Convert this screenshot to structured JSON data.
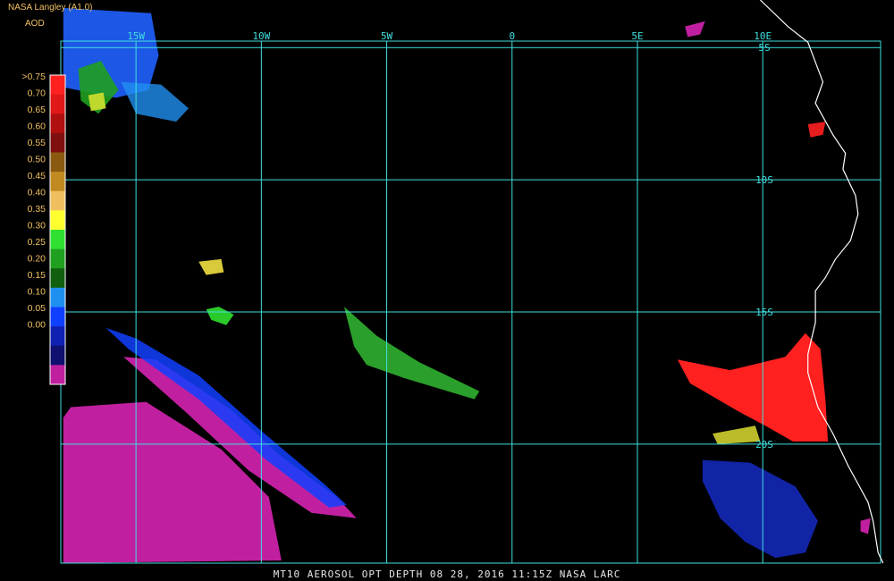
{
  "header": {
    "agency": "NASA Langley (A1.0)",
    "product": "AOD"
  },
  "footer": {
    "caption": "MT10  AEROSOL OPT DEPTH   08 28, 2016 11:15Z   NASA LARC"
  },
  "colors": {
    "background": "#000000",
    "grid": "#40e0e0",
    "coast": "#ffffff",
    "labels": "#f0c060"
  },
  "map": {
    "lon_range": [
      -18,
      14.7
    ],
    "lat_range": [
      -3.2,
      -24.5
    ],
    "lon_ticks": [
      {
        "value": -15,
        "label": "15W"
      },
      {
        "value": -10,
        "label": "10W"
      },
      {
        "value": -5,
        "label": "5W"
      },
      {
        "value": 0,
        "label": "0"
      },
      {
        "value": 5,
        "label": "5E"
      },
      {
        "value": 10,
        "label": "10E"
      }
    ],
    "lat_ticks": [
      {
        "value": -5,
        "label": "5S"
      },
      {
        "value": -10,
        "label": "10S"
      },
      {
        "value": -15,
        "label": "15S"
      },
      {
        "value": -20,
        "label": "20S"
      }
    ]
  },
  "colorbar": {
    "entries": [
      {
        "label": ">0.75",
        "color": "#ff2020"
      },
      {
        "label": "0.70",
        "color": "#e01818"
      },
      {
        "label": "0.65",
        "color": "#b01010"
      },
      {
        "label": "0.60",
        "color": "#801010"
      },
      {
        "label": "0.55",
        "color": "#8a5a10"
      },
      {
        "label": "0.50",
        "color": "#c08a20"
      },
      {
        "label": "0.45",
        "color": "#f0c060"
      },
      {
        "label": "0.40",
        "color": "#ffff30"
      },
      {
        "label": "0.35",
        "color": "#30e030"
      },
      {
        "label": "0.30",
        "color": "#20a020"
      },
      {
        "label": "0.25",
        "color": "#106010"
      },
      {
        "label": "0.20",
        "color": "#2090f0"
      },
      {
        "label": "0.15",
        "color": "#1040ff"
      },
      {
        "label": "0.10",
        "color": "#1020b0"
      },
      {
        "label": "0.05",
        "color": "#101070"
      },
      {
        "label": "0.00",
        "color": "#c020a0"
      }
    ]
  },
  "features": [
    {
      "name": "blob-nw-blue",
      "color": "#2060ff",
      "opacity": 0.9,
      "points": [
        [
          -17.9,
          -3.5
        ],
        [
          -14.4,
          -3.7
        ],
        [
          -14.1,
          -5.3
        ],
        [
          -14.5,
          -6.6
        ],
        [
          -15.8,
          -6.9
        ],
        [
          -17.9,
          -6.5
        ]
      ]
    },
    {
      "name": "blob-nw-lightblue",
      "color": "#2090f0",
      "opacity": 0.8,
      "points": [
        [
          -15.6,
          -6.3
        ],
        [
          -14.0,
          -6.4
        ],
        [
          -12.9,
          -7.3
        ],
        [
          -13.4,
          -7.8
        ],
        [
          -15.0,
          -7.5
        ]
      ]
    },
    {
      "name": "blob-nw-green",
      "color": "#20a020",
      "opacity": 0.9,
      "points": [
        [
          -17.3,
          -5.8
        ],
        [
          -16.4,
          -5.5
        ],
        [
          -15.7,
          -6.6
        ],
        [
          -16.5,
          -7.5
        ],
        [
          -17.2,
          -7.0
        ]
      ]
    },
    {
      "name": "blob-nw-yellow",
      "color": "#d0e030",
      "opacity": 0.9,
      "points": [
        [
          -16.9,
          -6.8
        ],
        [
          -16.3,
          -6.7
        ],
        [
          -16.2,
          -7.3
        ],
        [
          -16.8,
          -7.4
        ]
      ]
    },
    {
      "name": "blob-nw-magenta-small",
      "color": "#c020a0",
      "opacity": 1,
      "points": [
        [
          6.9,
          -4.2
        ],
        [
          7.7,
          -4.0
        ],
        [
          7.5,
          -4.5
        ],
        [
          7.0,
          -4.6
        ]
      ]
    },
    {
      "name": "blob-sw-magenta-1",
      "color": "#c020a0",
      "opacity": 1,
      "points": [
        [
          -17.6,
          -18.6
        ],
        [
          -14.6,
          -18.4
        ],
        [
          -11.6,
          -20.2
        ],
        [
          -9.7,
          -22.0
        ],
        [
          -9.2,
          -24.4
        ],
        [
          -17.9,
          -24.5
        ],
        [
          -17.9,
          -19.0
        ]
      ]
    },
    {
      "name": "blob-sw-magenta-2",
      "color": "#c020a0",
      "opacity": 1,
      "points": [
        [
          -15.5,
          -16.7
        ],
        [
          -14.2,
          -16.8
        ],
        [
          -11.2,
          -18.7
        ],
        [
          -9.3,
          -20.4
        ],
        [
          -7.0,
          -22.0
        ],
        [
          -6.2,
          -22.8
        ],
        [
          -8.0,
          -22.6
        ],
        [
          -10.5,
          -21.0
        ],
        [
          -13.0,
          -18.8
        ]
      ]
    },
    {
      "name": "blob-sw-blue-band",
      "color": "#1040ff",
      "opacity": 0.85,
      "points": [
        [
          -16.2,
          -15.6
        ],
        [
          -15.0,
          -16.0
        ],
        [
          -12.5,
          -17.4
        ],
        [
          -10.0,
          -19.5
        ],
        [
          -7.5,
          -21.5
        ],
        [
          -6.6,
          -22.3
        ],
        [
          -7.3,
          -22.4
        ],
        [
          -9.8,
          -20.6
        ],
        [
          -12.5,
          -18.3
        ],
        [
          -15.3,
          -16.4
        ]
      ]
    },
    {
      "name": "blob-center-green-band",
      "color": "#30b030",
      "opacity": 0.9,
      "points": [
        [
          -6.7,
          -14.8
        ],
        [
          -5.4,
          -15.9
        ],
        [
          -3.7,
          -16.9
        ],
        [
          -1.3,
          -18.0
        ],
        [
          -1.5,
          -18.3
        ],
        [
          -4.3,
          -17.5
        ],
        [
          -5.8,
          -17.0
        ],
        [
          -6.3,
          -16.3
        ]
      ]
    },
    {
      "name": "blob-center-small-green",
      "color": "#30e030",
      "opacity": 0.9,
      "points": [
        [
          -12.2,
          -14.9
        ],
        [
          -11.7,
          -14.8
        ],
        [
          -11.1,
          -15.1
        ],
        [
          -11.4,
          -15.5
        ],
        [
          -12.0,
          -15.3
        ]
      ]
    },
    {
      "name": "blob-center-small-yellow",
      "color": "#f0e040",
      "opacity": 0.9,
      "points": [
        [
          -12.5,
          -13.1
        ],
        [
          -11.6,
          -13.0
        ],
        [
          -11.5,
          -13.5
        ],
        [
          -12.2,
          -13.6
        ]
      ]
    },
    {
      "name": "blob-east-red",
      "color": "#ff2020",
      "opacity": 1,
      "points": [
        [
          8.7,
          -17.2
        ],
        [
          10.9,
          -16.7
        ],
        [
          11.7,
          -15.8
        ],
        [
          12.3,
          -16.4
        ],
        [
          12.5,
          -18.3
        ],
        [
          12.6,
          -19.9
        ],
        [
          11.2,
          -19.9
        ],
        [
          10.1,
          -19.3
        ],
        [
          9.1,
          -18.8
        ],
        [
          7.1,
          -17.7
        ],
        [
          6.6,
          -16.8
        ]
      ]
    },
    {
      "name": "blob-east-red-scatter",
      "color": "#ff2020",
      "opacity": 0.9,
      "points": [
        [
          11.8,
          -7.9
        ],
        [
          12.5,
          -7.8
        ],
        [
          12.4,
          -8.3
        ],
        [
          11.9,
          -8.4
        ]
      ]
    },
    {
      "name": "blob-east-multi",
      "color": "#d0d030",
      "opacity": 0.9,
      "points": [
        [
          8.0,
          -19.6
        ],
        [
          9.7,
          -19.3
        ],
        [
          9.9,
          -19.9
        ],
        [
          8.2,
          -20.0
        ]
      ]
    },
    {
      "name": "blob-se-blue",
      "color": "#1428b8",
      "opacity": 0.9,
      "points": [
        [
          7.6,
          -20.6
        ],
        [
          9.5,
          -20.7
        ],
        [
          11.3,
          -21.6
        ],
        [
          12.2,
          -22.9
        ],
        [
          11.7,
          -24.1
        ],
        [
          10.5,
          -24.3
        ],
        [
          9.3,
          -23.7
        ],
        [
          8.3,
          -22.8
        ],
        [
          7.6,
          -21.4
        ]
      ]
    },
    {
      "name": "blob-se-magenta-coast",
      "color": "#c020a0",
      "opacity": 1,
      "points": [
        [
          13.9,
          -22.9
        ],
        [
          14.3,
          -22.8
        ],
        [
          14.2,
          -23.4
        ],
        [
          13.9,
          -23.3
        ]
      ]
    }
  ],
  "coast": [
    [
      9.9,
      -3.2
    ],
    [
      11.0,
      -4.2
    ],
    [
      11.8,
      -4.8
    ],
    [
      12.2,
      -5.8
    ],
    [
      12.4,
      -6.3
    ],
    [
      12.1,
      -7.1
    ],
    [
      12.8,
      -8.3
    ],
    [
      13.3,
      -9.0
    ],
    [
      13.2,
      -9.6
    ],
    [
      13.7,
      -10.6
    ],
    [
      13.8,
      -11.3
    ],
    [
      13.5,
      -12.3
    ],
    [
      12.9,
      -13.0
    ],
    [
      12.5,
      -13.7
    ],
    [
      12.1,
      -14.2
    ],
    [
      12.1,
      -15.4
    ],
    [
      11.8,
      -16.6
    ],
    [
      11.8,
      -17.3
    ],
    [
      12.2,
      -18.6
    ],
    [
      12.8,
      -19.6
    ],
    [
      13.4,
      -20.8
    ],
    [
      14.2,
      -22.2
    ],
    [
      14.4,
      -22.9
    ],
    [
      14.6,
      -24.1
    ],
    [
      14.8,
      -24.5
    ]
  ]
}
